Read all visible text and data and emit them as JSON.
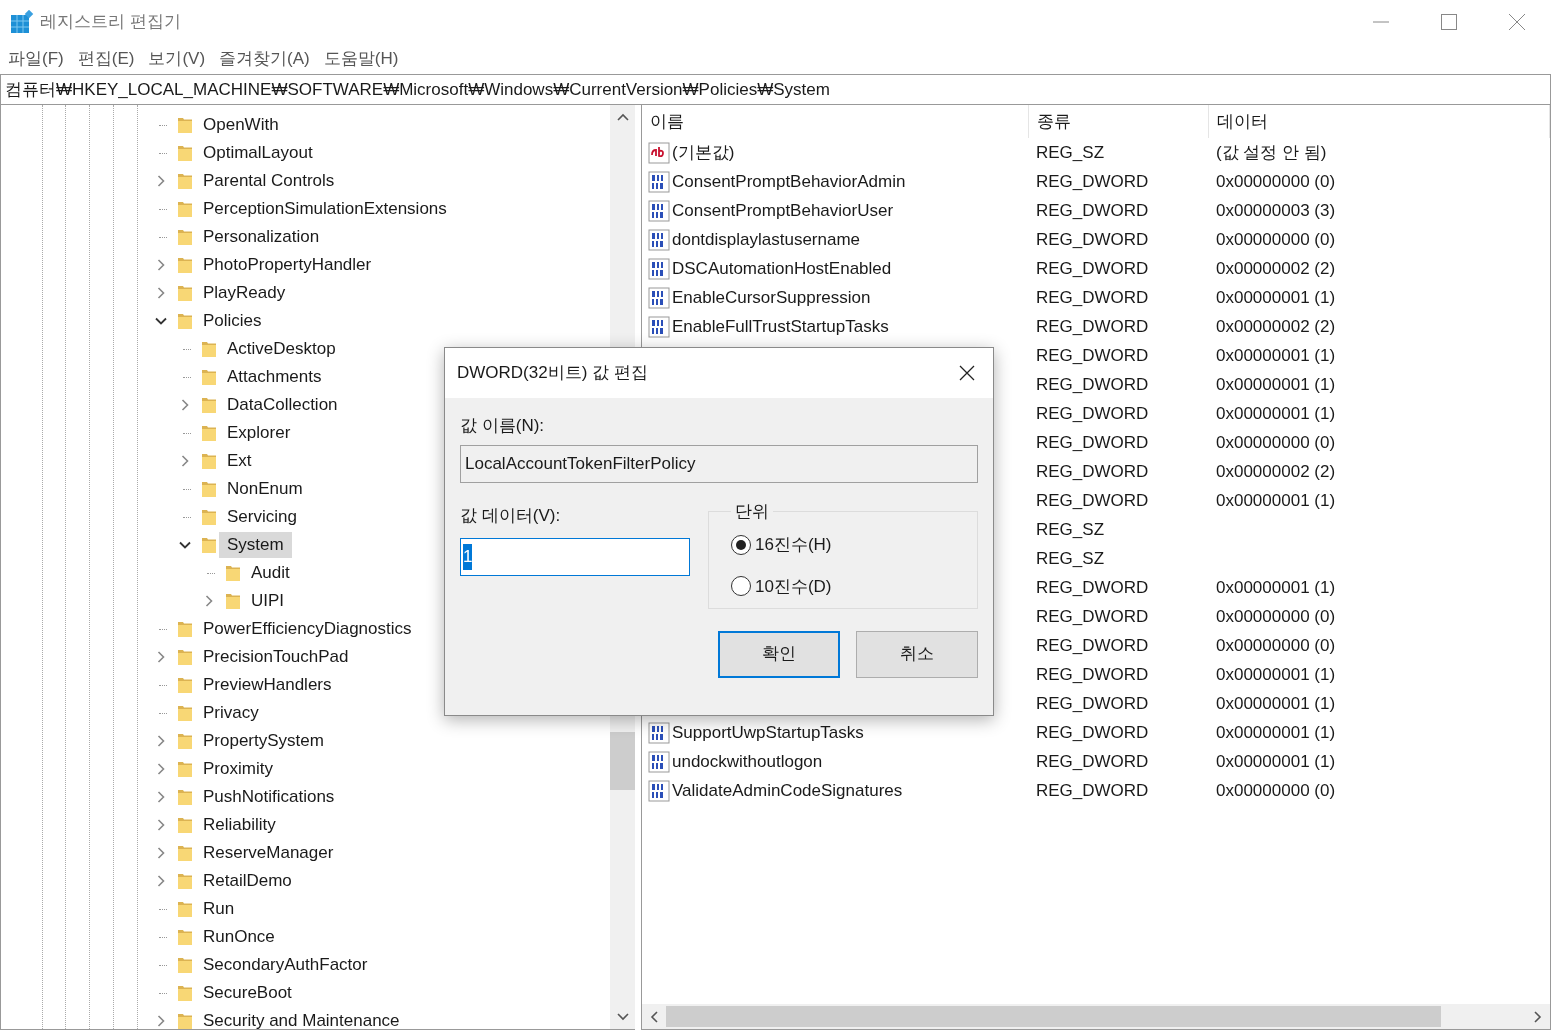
{
  "window": {
    "title": "레지스트리 편집기"
  },
  "menu": [
    "파일(F)",
    "편집(E)",
    "보기(V)",
    "즐겨찾기(A)",
    "도움말(H)"
  ],
  "address": "컴퓨터₩HKEY_LOCAL_MACHINE₩SOFTWARE₩Microsoft₩Windows₩CurrentVersion₩Policies₩System",
  "tree": [
    {
      "label": "OpenWith",
      "selected": false
    },
    {
      "label": "OptimalLayout",
      "selected": false
    },
    {
      "label": "Parental Controls",
      "expanded": false,
      "selected": false
    },
    {
      "label": "PerceptionSimulationExtensions",
      "selected": false
    },
    {
      "label": "Personalization",
      "selected": false
    },
    {
      "label": "PhotoPropertyHandler",
      "expanded": false,
      "selected": false
    },
    {
      "label": "PlayReady",
      "expanded": false,
      "selected": false
    },
    {
      "label": "Policies",
      "expanded": true,
      "selected": false,
      "children": [
        {
          "label": "ActiveDesktop",
          "selected": false
        },
        {
          "label": "Attachments",
          "selected": false
        },
        {
          "label": "DataCollection",
          "expanded": false,
          "selected": false
        },
        {
          "label": "Explorer",
          "selected": false
        },
        {
          "label": "Ext",
          "expanded": false,
          "selected": false
        },
        {
          "label": "NonEnum",
          "selected": false
        },
        {
          "label": "Servicing",
          "selected": false
        },
        {
          "label": "System",
          "expanded": true,
          "selected": true,
          "children": [
            {
              "label": "Audit",
              "selected": false
            },
            {
              "label": "UIPI",
              "expanded": false,
              "selected": false
            }
          ]
        }
      ]
    },
    {
      "label": "PowerEfficiencyDiagnostics",
      "selected": false
    },
    {
      "label": "PrecisionTouchPad",
      "expanded": false,
      "selected": false
    },
    {
      "label": "PreviewHandlers",
      "selected": false
    },
    {
      "label": "Privacy",
      "selected": false
    },
    {
      "label": "PropertySystem",
      "expanded": false,
      "selected": false
    },
    {
      "label": "Proximity",
      "expanded": false,
      "selected": false
    },
    {
      "label": "PushNotifications",
      "expanded": false,
      "selected": false
    },
    {
      "label": "Reliability",
      "expanded": false,
      "selected": false
    },
    {
      "label": "ReserveManager",
      "expanded": false,
      "selected": false
    },
    {
      "label": "RetailDemo",
      "expanded": false,
      "selected": false
    },
    {
      "label": "Run",
      "selected": false
    },
    {
      "label": "RunOnce",
      "selected": false
    },
    {
      "label": "SecondaryAuthFactor",
      "selected": false
    },
    {
      "label": "SecureBoot",
      "selected": false
    },
    {
      "label": "Security and Maintenance",
      "expanded": false,
      "selected": false
    }
  ],
  "values": {
    "columns": [
      "이름",
      "종류",
      "데이터"
    ],
    "rows": [
      {
        "kind": "string",
        "name": "(기본값)",
        "type": "REG_SZ",
        "data": "(값 설정 안 됨)"
      },
      {
        "kind": "dword",
        "name": "ConsentPromptBehaviorAdmin",
        "type": "REG_DWORD",
        "data": "0x00000000 (0)"
      },
      {
        "kind": "dword",
        "name": "ConsentPromptBehaviorUser",
        "type": "REG_DWORD",
        "data": "0x00000003 (3)"
      },
      {
        "kind": "dword",
        "name": "dontdisplaylastusername",
        "type": "REG_DWORD",
        "data": "0x00000000 (0)"
      },
      {
        "kind": "dword",
        "name": "DSCAutomationHostEnabled",
        "type": "REG_DWORD",
        "data": "0x00000002 (2)"
      },
      {
        "kind": "dword",
        "name": "EnableCursorSuppression",
        "type": "REG_DWORD",
        "data": "0x00000001 (1)"
      },
      {
        "kind": "dword",
        "name": "EnableFullTrustStartupTasks",
        "type": "REG_DWORD",
        "data": "0x00000002 (2)"
      },
      {
        "type": "REG_DWORD",
        "data": "0x00000001 (1)"
      },
      {
        "type": "REG_DWORD",
        "data": "0x00000001 (1)"
      },
      {
        "type": "REG_DWORD",
        "data": "0x00000001 (1)"
      },
      {
        "type": "REG_DWORD",
        "data": "0x00000000 (0)"
      },
      {
        "type": "REG_DWORD",
        "data": "0x00000002 (2)"
      },
      {
        "type": "REG_DWORD",
        "data": "0x00000001 (1)"
      },
      {
        "type": "REG_SZ"
      },
      {
        "type": "REG_SZ"
      },
      {
        "type": "REG_DWORD",
        "data": "0x00000001 (1)"
      },
      {
        "type": "REG_DWORD",
        "data": "0x00000000 (0)"
      },
      {
        "type": "REG_DWORD",
        "data": "0x00000000 (0)"
      },
      {
        "type": "REG_DWORD",
        "data": "0x00000001 (1)"
      },
      {
        "type": "REG_DWORD",
        "data": "0x00000001 (1)"
      },
      {
        "kind": "dword",
        "name": "SupportUwpStartupTasks",
        "type": "REG_DWORD",
        "data": "0x00000001 (1)"
      },
      {
        "kind": "dword",
        "name": "undockwithoutlogon",
        "type": "REG_DWORD",
        "data": "0x00000001 (1)"
      },
      {
        "kind": "dword",
        "name": "ValidateAdminCodeSignatures",
        "type": "REG_DWORD",
        "data": "0x00000000 (0)"
      }
    ]
  },
  "dialog": {
    "title": "DWORD(32비트) 값 편집",
    "name_label": "값 이름(N):",
    "name_value": "LocalAccountTokenFilterPolicy",
    "data_label": "값 데이터(V):",
    "data_value": "1",
    "base_label": "단위",
    "bases": [
      {
        "label": "16진수(H)",
        "selected": true
      },
      {
        "label": "10진수(D)",
        "selected": false
      }
    ],
    "buttons": [
      {
        "label": "확인",
        "default": true
      },
      {
        "label": "취소",
        "default": false
      }
    ]
  }
}
